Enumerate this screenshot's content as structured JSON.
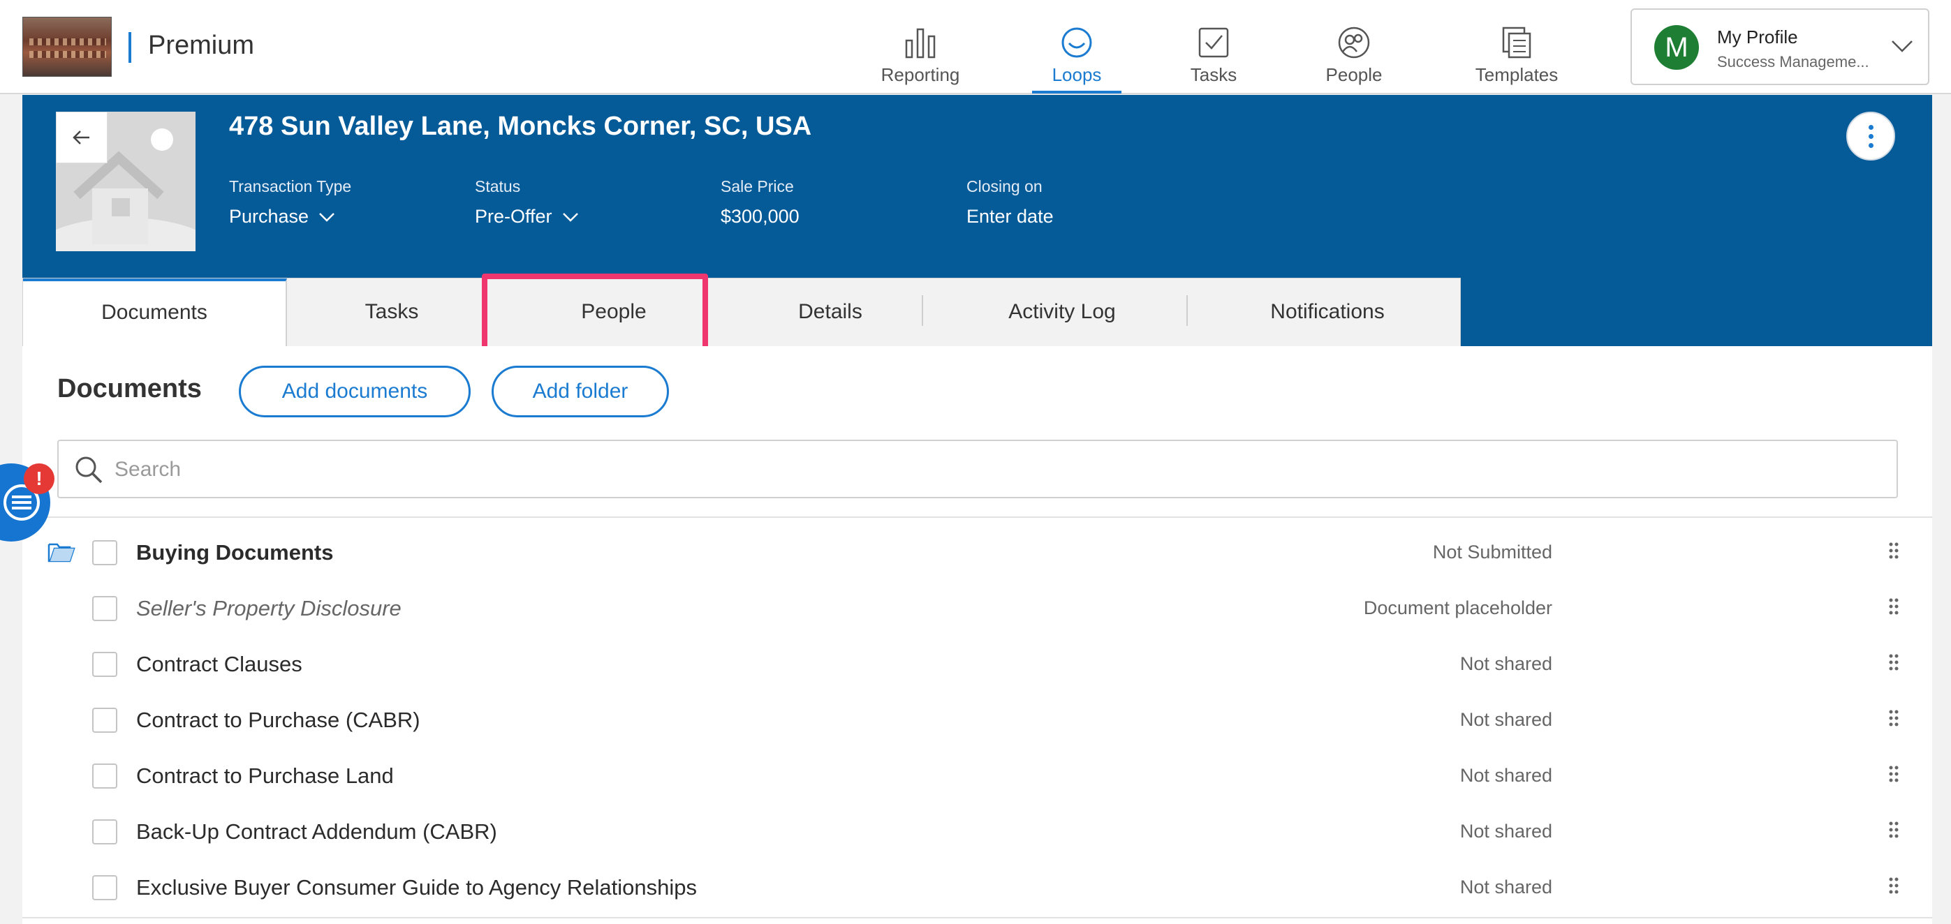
{
  "app": {
    "brand": "Premium"
  },
  "nav": {
    "items": [
      {
        "label": "Reporting",
        "icon": "bar-chart-icon"
      },
      {
        "label": "Loops",
        "icon": "loop-icon",
        "active": true
      },
      {
        "label": "Tasks",
        "icon": "checkbox-icon"
      },
      {
        "label": "People",
        "icon": "people-icon"
      },
      {
        "label": "Templates",
        "icon": "templates-icon"
      }
    ],
    "accent": "#1a7bd1"
  },
  "profile": {
    "initial": "M",
    "name": "My Profile",
    "subtitle": "Success Manageme...",
    "avatar_color": "#1e7e34"
  },
  "loop": {
    "address": "478 Sun Valley Lane, Moncks Corner, SC, USA",
    "fields": [
      {
        "label": "Transaction Type",
        "value": "Purchase",
        "dropdown": true
      },
      {
        "label": "Status",
        "value": "Pre-Offer",
        "dropdown": true
      },
      {
        "label": "Sale Price",
        "value": "$300,000",
        "dropdown": false
      },
      {
        "label": "Closing on",
        "value": "Enter date",
        "dropdown": false
      }
    ],
    "header_color": "#055a98"
  },
  "tabs": [
    {
      "label": "Documents",
      "active": true
    },
    {
      "label": "Tasks"
    },
    {
      "label": "People",
      "highlighted": true
    },
    {
      "label": "Details"
    },
    {
      "label": "Activity Log"
    },
    {
      "label": "Notifications"
    }
  ],
  "highlight_color": "#f0366e",
  "documents": {
    "title": "Documents",
    "add_documents": "Add documents",
    "add_folder": "Add folder",
    "search_placeholder": "Search",
    "rows": [
      {
        "name": "Buying Documents",
        "status": "Not Submitted",
        "type": "folder"
      },
      {
        "name": "Seller's Property Disclosure",
        "status": "Document placeholder",
        "type": "placeholder"
      },
      {
        "name": "Contract Clauses",
        "status": "Not shared",
        "type": "doc"
      },
      {
        "name": "Contract to Purchase (CABR)",
        "status": "Not shared",
        "type": "doc"
      },
      {
        "name": "Contract to Purchase Land",
        "status": "Not shared",
        "type": "doc"
      },
      {
        "name": "Back-Up Contract Addendum (CABR)",
        "status": "Not shared",
        "type": "doc"
      },
      {
        "name": "Exclusive Buyer Consumer Guide to Agency Relationships",
        "status": "Not shared",
        "type": "doc"
      }
    ]
  },
  "chat": {
    "badge": "!"
  }
}
